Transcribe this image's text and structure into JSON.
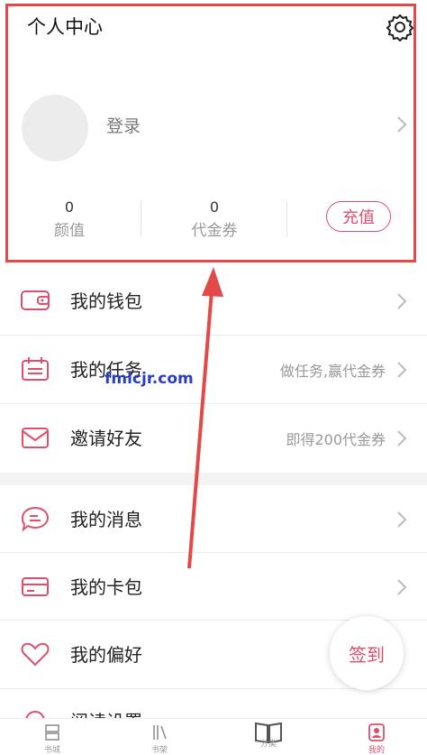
{
  "header": {
    "title": "个人中心",
    "login_label": "登录",
    "stats": [
      {
        "value": "0",
        "label": "颜值"
      },
      {
        "value": "0",
        "label": "代金券"
      }
    ],
    "recharge_label": "充值"
  },
  "menu": [
    {
      "label": "我的钱包",
      "hint": "",
      "icon": "wallet-icon"
    },
    {
      "label": "我的任务",
      "hint": "做任务,赢代金券",
      "icon": "calendar-task-icon"
    },
    {
      "label": "邀请好友",
      "hint": "即得200代金券",
      "icon": "envelope-icon"
    },
    {
      "label": "我的消息",
      "hint": "",
      "icon": "chat-bubble-icon"
    },
    {
      "label": "我的卡包",
      "hint": "",
      "icon": "card-icon"
    },
    {
      "label": "我的偏好",
      "hint": "",
      "icon": "heart-icon"
    },
    {
      "label": "阅读设置",
      "hint": "",
      "icon": "settings-icon"
    }
  ],
  "signin_label": "签到",
  "watermark": "fmlcjr.com",
  "bottom_nav": [
    {
      "label": "书城",
      "icon": "bookstore-icon",
      "active": false
    },
    {
      "label": "书架",
      "icon": "bookshelf-icon",
      "active": false
    },
    {
      "label": "分类",
      "icon": "open-book-icon",
      "active": false
    },
    {
      "label": "我的",
      "icon": "profile-icon",
      "active": true
    }
  ],
  "colors": {
    "accent": "#dd4f6d",
    "highlight_box": "#e24a4a"
  }
}
